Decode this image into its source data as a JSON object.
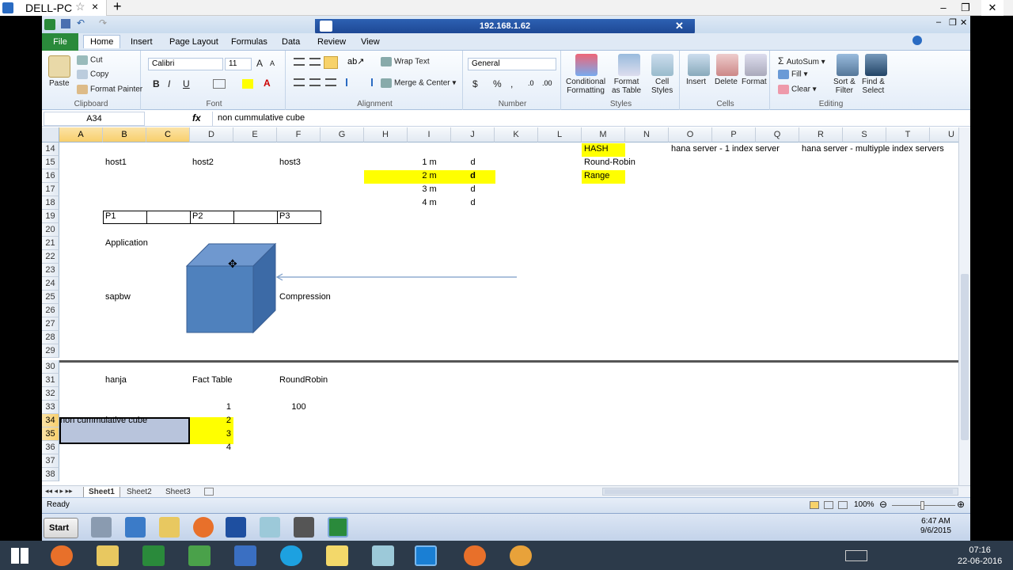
{
  "browser": {
    "tab_title": "DELL-PC",
    "close_glyph": "×",
    "newtab_glyph": "+",
    "star_glyph": "☆",
    "min_glyph": "–",
    "max_glyph": "❐",
    "close_win_glyph": "✕"
  },
  "remote": {
    "host": "192.168.1.62"
  },
  "ribbon": {
    "tabs": [
      "File",
      "Home",
      "Insert",
      "Page Layout",
      "Formulas",
      "Data",
      "Review",
      "View"
    ],
    "clipboard": {
      "paste": "Paste",
      "cut": "Cut",
      "copy": "Copy",
      "format_painter": "Format Painter",
      "label": "Clipboard"
    },
    "font": {
      "name": "Calibri",
      "size": "11",
      "bold": "B",
      "italic": "I",
      "underline": "U",
      "grow": "A",
      "shrink": "A",
      "label": "Font"
    },
    "alignment": {
      "wrap": "Wrap Text",
      "merge": "Merge & Center",
      "label": "Alignment"
    },
    "number": {
      "format": "General",
      "currency": "$",
      "percent": "%",
      "comma": ",",
      "label": "Number"
    },
    "styles": {
      "conditional": "Conditional",
      "conditional2": "Formatting",
      "format_table": "Format",
      "format_table2": "as Table",
      "cell_styles": "Cell",
      "cell_styles2": "Styles",
      "label": "Styles"
    },
    "cells": {
      "insert": "Insert",
      "delete": "Delete",
      "format": "Format",
      "label": "Cells"
    },
    "editing": {
      "autosum": "AutoSum",
      "fill": "Fill",
      "clear": "Clear",
      "sort": "Sort &",
      "sort2": "Filter",
      "find": "Find &",
      "find2": "Select",
      "label": "Editing"
    }
  },
  "formula_bar": {
    "name_box": "A34",
    "fx": "fx",
    "value": "non cummulative cube"
  },
  "grid": {
    "columns": [
      "A",
      "B",
      "C",
      "D",
      "E",
      "F",
      "G",
      "H",
      "I",
      "J",
      "K",
      "L",
      "M",
      "N",
      "O",
      "P",
      "Q",
      "R",
      "S",
      "T",
      "U"
    ],
    "rows": [
      "14",
      "15",
      "16",
      "17",
      "18",
      "19",
      "20",
      "21",
      "22",
      "23",
      "24",
      "25",
      "26",
      "27",
      "28",
      "29",
      "30",
      "31",
      "32",
      "33",
      "34",
      "35",
      "36",
      "37",
      "38"
    ],
    "cells": {
      "m14": "HASH",
      "o14": "hana server - 1 index server",
      "r14": "hana server - multiyple index servers",
      "b15": "host1",
      "d15": "host2",
      "f15": "host3",
      "i15": "1 m",
      "j15": "d",
      "m15": "Round-Robin",
      "i16": "2 m",
      "j16": "d",
      "m16": "Range",
      "i17": "3 m",
      "j17": "d",
      "i18": "4 m",
      "j18": "d",
      "b19": "P1",
      "d19": "P2",
      "f19": "P3",
      "b21": "Application",
      "b25": "sapbw",
      "f25": "Compression",
      "b31": "hanja",
      "d31": "Fact Table",
      "f31": "RoundRobin",
      "d33": "1",
      "f33": "100",
      "a34": "non cummulative cube",
      "d34": "2",
      "d35": "3",
      "d36": "4"
    }
  },
  "sheets": [
    "Sheet1",
    "Sheet2",
    "Sheet3"
  ],
  "status": {
    "ready": "Ready",
    "zoom": "100%"
  },
  "xp_taskbar": {
    "start": "Start",
    "time": "6:47 AM",
    "date": "9/6/2015"
  },
  "win10": {
    "time": "07:16",
    "date": "22-06-2016"
  },
  "colors": {
    "excel_green": "#2a8a3b",
    "highlight_yellow": "#ffff00",
    "selection": "#b8c4dc",
    "cube_front": "#4f81bd",
    "cube_top": "#6f98cf",
    "cube_side": "#3c6aa6"
  }
}
